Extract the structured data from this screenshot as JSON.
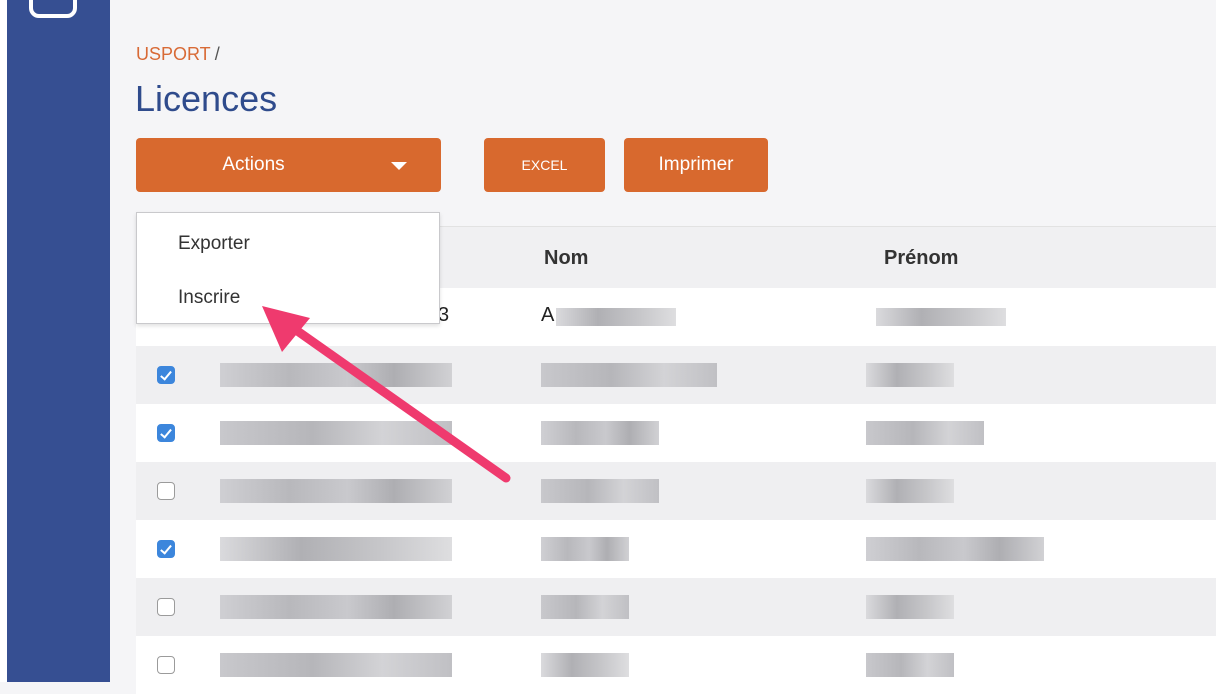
{
  "breadcrumb": {
    "root": "USPORT",
    "separator": "/"
  },
  "page": {
    "title": "Licences"
  },
  "toolbar": {
    "actions_label": "Actions",
    "excel_label": "EXCEL",
    "print_label": "Imprimer"
  },
  "dropdown": {
    "items": [
      {
        "label": "Exporter"
      },
      {
        "label": "Inscrire"
      }
    ]
  },
  "table": {
    "columns": [
      "",
      "Nom",
      "Prénom"
    ],
    "first_row": {
      "col1_fragment": "3",
      "nom_fragment": "A"
    },
    "rows": [
      {
        "checked": true
      },
      {
        "checked": true
      },
      {
        "checked": false
      },
      {
        "checked": true
      },
      {
        "checked": false
      },
      {
        "checked": false
      }
    ]
  },
  "colors": {
    "accent_orange": "#d8692e",
    "sidebar_blue": "#364f92",
    "title_blue": "#2f4b8c",
    "checkbox_blue": "#3c86dc",
    "annotation_pink": "#ef3a6e"
  }
}
